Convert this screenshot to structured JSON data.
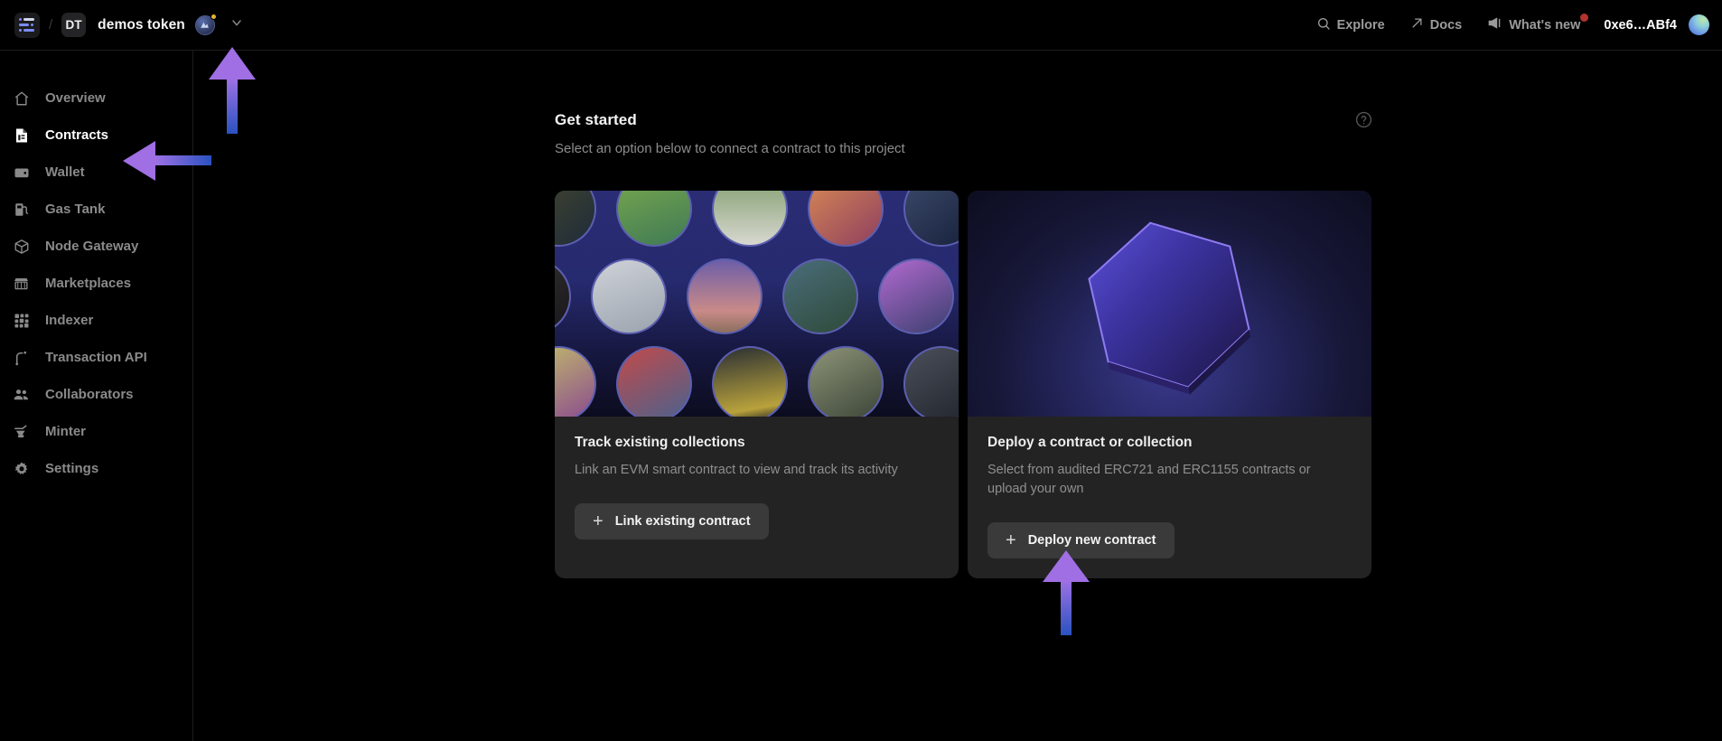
{
  "header": {
    "menu_icon": "sidebar-toggle-icon",
    "separator": "/",
    "project_initials": "DT",
    "project_name": "demos token",
    "chain_badge_icon": "chain-network-icon",
    "chevron_icon": "chevron-down-icon",
    "nav": [
      {
        "label": "Explore",
        "icon": "search-icon"
      },
      {
        "label": "Docs",
        "icon": "external-link-icon"
      },
      {
        "label": "What's new",
        "icon": "megaphone-icon",
        "badge": true
      }
    ],
    "wallet_address": "0xe6…ABf4",
    "avatar_icon": "user-avatar"
  },
  "sidebar": {
    "items": [
      {
        "label": "Overview",
        "icon": "home-icon",
        "active": false
      },
      {
        "label": "Contracts",
        "icon": "contract-document-icon",
        "active": true
      },
      {
        "label": "Wallet",
        "icon": "wallet-icon",
        "active": false
      },
      {
        "label": "Gas Tank",
        "icon": "gas-pump-icon",
        "active": false
      },
      {
        "label": "Node Gateway",
        "icon": "cube-icon",
        "active": false
      },
      {
        "label": "Marketplaces",
        "icon": "storefront-icon",
        "active": false
      },
      {
        "label": "Indexer",
        "icon": "grid-blocks-icon",
        "active": false
      },
      {
        "label": "Transaction API",
        "icon": "transaction-arc-icon",
        "active": false
      },
      {
        "label": "Collaborators",
        "icon": "people-icon",
        "active": false
      },
      {
        "label": "Minter",
        "icon": "anvil-icon",
        "active": false
      },
      {
        "label": "Settings",
        "icon": "gear-icon",
        "active": false
      }
    ]
  },
  "main": {
    "section_title": "Get started",
    "section_subtitle": "Select an option below to connect a contract to this project",
    "help_icon": "help-circle-icon",
    "cards": [
      {
        "image": "nft-collection-grid-image",
        "title": "Track existing collections",
        "description": "Link an EVM smart contract to view and track its activity",
        "button_label": "Link existing contract",
        "button_icon": "plus-icon"
      },
      {
        "image": "hexagon-3d-image",
        "title": "Deploy a contract or collection",
        "description": "Select from audited ERC721 and ERC1155 contracts or upload your own",
        "button_label": "Deploy new contract",
        "button_icon": "plus-icon"
      }
    ]
  },
  "annotations": [
    {
      "name": "arrow-up-to-project-switcher",
      "direction": "up"
    },
    {
      "name": "arrow-left-to-contracts-nav",
      "direction": "left"
    },
    {
      "name": "arrow-up-to-deploy-button",
      "direction": "up"
    }
  ],
  "colors": {
    "accent_purple": "#9b6fe0",
    "accent_blue": "#2d56c4",
    "active_text": "#ffffff",
    "muted_text": "#8a8a8a",
    "card_bg": "#232323",
    "button_bg": "#3a3a3a",
    "badge_red": "#b3332e"
  }
}
